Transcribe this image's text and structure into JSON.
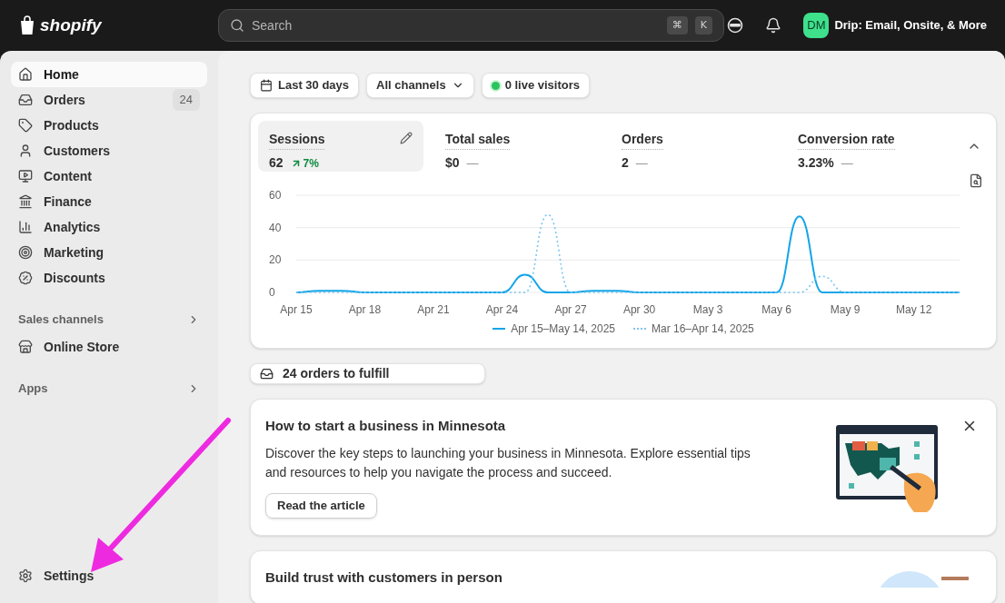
{
  "topbar": {
    "logo": "shopify",
    "search": {
      "placeholder": "Search",
      "keys": [
        "⌘",
        "K"
      ]
    },
    "store": {
      "initials": "DM",
      "name": "Drip: Email, Onsite, & More"
    }
  },
  "sidebar": {
    "items": [
      {
        "label": "Home",
        "selected": true
      },
      {
        "label": "Orders",
        "selected": false,
        "badge": "24"
      },
      {
        "label": "Products",
        "selected": false
      },
      {
        "label": "Customers",
        "selected": false
      },
      {
        "label": "Content",
        "selected": false
      },
      {
        "label": "Finance",
        "selected": false
      },
      {
        "label": "Analytics",
        "selected": false
      },
      {
        "label": "Marketing",
        "selected": false
      },
      {
        "label": "Discounts",
        "selected": false
      }
    ],
    "sections": [
      {
        "title": "Sales channels",
        "items": [
          {
            "label": "Online Store",
            "selected": false
          }
        ]
      },
      {
        "title": "Apps"
      }
    ],
    "settings": "Settings"
  },
  "filters": [
    {
      "kind": "date",
      "label": "Last 30 days"
    },
    {
      "kind": "dropdown",
      "label": "All channels"
    },
    {
      "kind": "live",
      "label": "0 live visitors"
    }
  ],
  "metrics": [
    {
      "title": "Sessions",
      "value": "62",
      "kind": "up",
      "change": "7%",
      "selected": true
    },
    {
      "title": "Total sales",
      "value": "$0",
      "kind": "flat",
      "change": "—",
      "selected": false
    },
    {
      "title": "Orders",
      "value": "2",
      "kind": "flat",
      "change": "—",
      "selected": false
    },
    {
      "title": "Conversion rate",
      "value": "3.23%",
      "kind": "flat",
      "change": "—",
      "selected": false
    }
  ],
  "chart_data": {
    "type": "line",
    "categories": [
      "Apr 15",
      null,
      null,
      "Apr 18",
      null,
      null,
      "Apr 21",
      null,
      null,
      "Apr 24",
      null,
      null,
      "Apr 27",
      null,
      null,
      "Apr 30",
      null,
      null,
      "May 3",
      null,
      null,
      "May 6",
      null,
      null,
      "May 9",
      null,
      null,
      "May 12",
      null,
      null
    ],
    "series": [
      {
        "name": "Apr 15–May 14, 2025",
        "color": "#13a5e8",
        "line_style": "solid",
        "values": [
          0,
          1,
          1,
          0,
          0,
          0,
          0,
          0,
          0,
          0,
          11,
          0,
          0,
          1,
          1,
          0,
          0,
          0,
          0,
          0,
          0,
          0,
          47,
          0,
          0,
          0,
          0,
          0,
          0,
          0
        ]
      },
      {
        "name": "Mar 16–Apr 14, 2025",
        "color": "#7cc6ef",
        "line_style": "dashed",
        "values": [
          0,
          0,
          0,
          0,
          0,
          0,
          0,
          0,
          0,
          0,
          0,
          48,
          0,
          0,
          0,
          0,
          0,
          0,
          0,
          0,
          0,
          0,
          0,
          10,
          0,
          0,
          0,
          0,
          0,
          0
        ]
      }
    ],
    "ylim": [
      0,
      60
    ],
    "yticks": [
      0,
      20,
      40,
      60
    ]
  },
  "fulfill": "24 orders to fulfill",
  "cards": [
    {
      "title": "How to start a business in Minnesota",
      "body": "Discover the key steps to launching your business in Minnesota. Explore essential tips and resources to help you navigate the process and succeed.",
      "button": "Read the article"
    },
    {
      "title": "Build trust with customers in person"
    }
  ]
}
